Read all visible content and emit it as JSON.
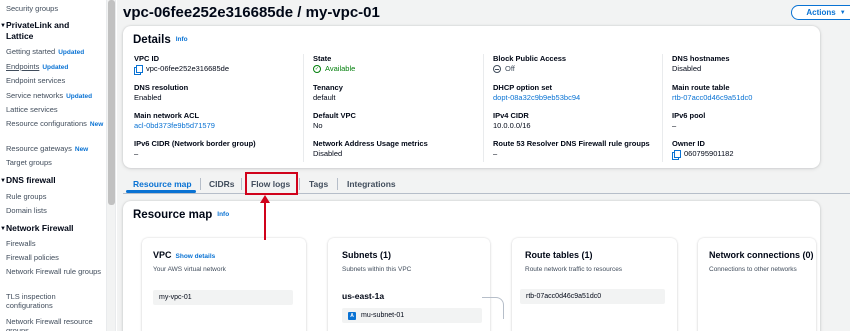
{
  "sidebar": {
    "items": [
      {
        "label": "Security groups"
      },
      {
        "section": "PrivateLink and Lattice"
      },
      {
        "label": "Getting started",
        "badge": "Updated"
      },
      {
        "label": "Endpoints",
        "badge": "Updated"
      },
      {
        "label": "Endpoint services"
      },
      {
        "label": "Service networks",
        "badge": "Updated"
      },
      {
        "label": "Lattice services"
      },
      {
        "label": "Resource configurations",
        "badge": "New"
      },
      {
        "label": "Resource gateways",
        "badge": "New"
      },
      {
        "label": "Target groups"
      },
      {
        "section": "DNS firewall"
      },
      {
        "label": "Rule groups"
      },
      {
        "label": "Domain lists"
      },
      {
        "section": "Network Firewall"
      },
      {
        "label": "Firewalls"
      },
      {
        "label": "Firewall policies"
      },
      {
        "label": "Network Firewall rule groups"
      },
      {
        "label": "TLS inspection configurations"
      },
      {
        "label": "Network Firewall resource groups"
      }
    ]
  },
  "header": {
    "title": "vpc-06fee252e316685de / my-vpc-01",
    "actions_label": "Actions",
    "actions_caret": "▼"
  },
  "details": {
    "title": "Details",
    "info": "Info",
    "fields": [
      {
        "label": "VPC ID",
        "value": "vpc-06fee252e316685de",
        "icon": "copy-icon"
      },
      {
        "label": "State",
        "value": "Available",
        "icon": "check-circle-icon",
        "color": "#037f0c"
      },
      {
        "label": "Block Public Access",
        "value": "Off",
        "icon": "off-icon"
      },
      {
        "label": "DNS hostnames",
        "value": "Disabled"
      },
      {
        "label": "DNS resolution",
        "value": "Enabled"
      },
      {
        "label": "Tenancy",
        "value": "default"
      },
      {
        "label": "DHCP option set",
        "value": "dopt-08a32c9b9eb53bc94",
        "link": true
      },
      {
        "label": "Main route table",
        "value": "rtb-07acc0d46c9a51dc0",
        "link": true
      },
      {
        "label": "Main network ACL",
        "value": "acl-0bd373fe9b5d71579",
        "link": true
      },
      {
        "label": "Default VPC",
        "value": "No"
      },
      {
        "label": "IPv4 CIDR",
        "value": "10.0.0.0/16"
      },
      {
        "label": "IPv6 pool",
        "value": "–"
      },
      {
        "label": "IPv6 CIDR (Network border group)",
        "value": "–"
      },
      {
        "label": "Network Address Usage metrics",
        "value": "Disabled"
      },
      {
        "label": "Route 53 Resolver DNS Firewall rule groups",
        "value": "–"
      },
      {
        "label": "Owner ID",
        "value": "060795901182",
        "icon": "copy-icon"
      }
    ]
  },
  "tabs": [
    {
      "label": "Resource map",
      "active": true
    },
    {
      "label": "CIDRs"
    },
    {
      "label": "Flow logs",
      "highlighted": true
    },
    {
      "label": "Tags"
    },
    {
      "label": "Integrations"
    }
  ],
  "resource_map": {
    "title": "Resource map",
    "info": "Info",
    "vpc": {
      "title": "VPC",
      "link": "Show details",
      "subtitle": "Your AWS virtual network",
      "item": "my-vpc-01"
    },
    "subnets": {
      "title": "Subnets (1)",
      "subtitle": "Subnets within this VPC",
      "az": "us-east-1a",
      "item": "mu-subnet-01",
      "item_icon": "subnet-icon"
    },
    "route_tables": {
      "title": "Route tables (1)",
      "subtitle": "Route network traffic to resources",
      "item": "rtb-07acc0d46c9a51dc0"
    },
    "connections": {
      "title": "Network connections (0)",
      "subtitle": "Connections to other networks"
    }
  },
  "colors": {
    "accent": "#0972d3",
    "success": "#037f0c",
    "annotation": "#d0021b",
    "background": "#f2f3f3"
  }
}
